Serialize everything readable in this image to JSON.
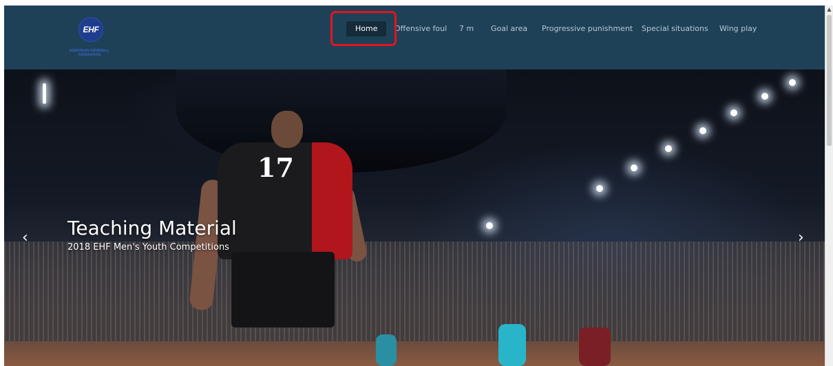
{
  "logo": {
    "text": "EHF",
    "subtitle": "EUROPEAN HANDBALL FEDERATION"
  },
  "nav": {
    "items": [
      {
        "label": "Home",
        "active": true
      },
      {
        "label": "Offensive foul",
        "active": false
      },
      {
        "label": "7 m",
        "active": false
      },
      {
        "label": "Goal area",
        "active": false
      },
      {
        "label": "Progressive punishment",
        "active": false
      },
      {
        "label": "Special situations",
        "active": false
      },
      {
        "label": "Wing play",
        "active": false
      }
    ]
  },
  "hero": {
    "title": "Teaching Material",
    "subtitle": "2018 EHF Men's Youth Competitions",
    "prev_icon": "chevron-left-icon",
    "next_icon": "chevron-right-icon",
    "player_number": "17"
  },
  "colors": {
    "header_bg": "#1e4158",
    "nav_text": "#b9c9d4",
    "nav_active_bg": "#152b3a",
    "highlight": "#e4141b"
  }
}
